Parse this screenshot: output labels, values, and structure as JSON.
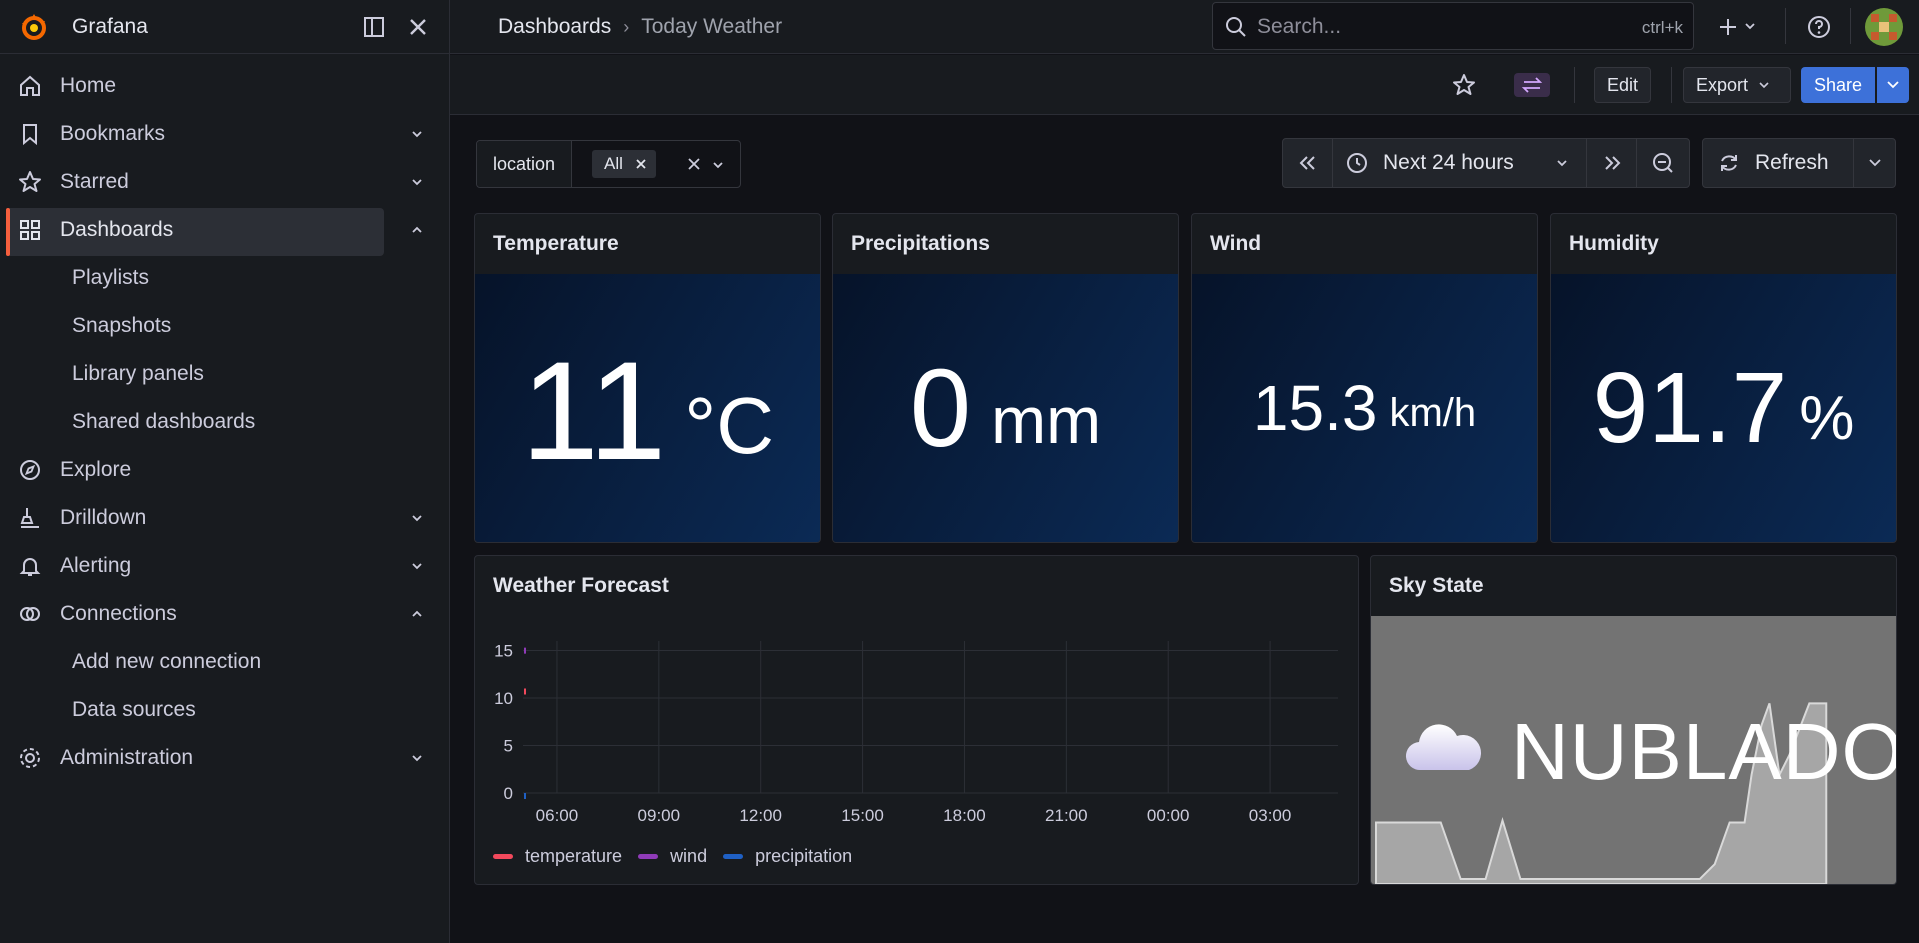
{
  "app": {
    "name": "Grafana"
  },
  "sidebar": {
    "items": [
      {
        "label": "Home",
        "icon": "home-icon"
      },
      {
        "label": "Bookmarks",
        "icon": "bookmark-icon"
      },
      {
        "label": "Starred",
        "icon": "star-icon"
      },
      {
        "label": "Dashboards",
        "icon": "dashboards-icon",
        "active": true
      },
      {
        "label": "Playlists"
      },
      {
        "label": "Snapshots"
      },
      {
        "label": "Library panels"
      },
      {
        "label": "Shared dashboards"
      },
      {
        "label": "Explore",
        "icon": "compass-icon"
      },
      {
        "label": "Drilldown",
        "icon": "drilldown-icon"
      },
      {
        "label": "Alerting",
        "icon": "bell-icon"
      },
      {
        "label": "Connections",
        "icon": "connections-icon"
      },
      {
        "label": "Add new connection"
      },
      {
        "label": "Data sources"
      },
      {
        "label": "Administration",
        "icon": "gear-icon"
      }
    ]
  },
  "header": {
    "breadcrumb": [
      "Dashboards",
      "Today Weather"
    ],
    "search_placeholder": "Search...",
    "search_shortcut": "ctrl+k"
  },
  "toolbar": {
    "edit_label": "Edit",
    "export_label": "Export",
    "share_label": "Share"
  },
  "variables": {
    "name": "location",
    "value": "All"
  },
  "time": {
    "range_label": "Next 24 hours",
    "refresh_label": "Refresh"
  },
  "panels": {
    "temperature": {
      "title": "Temperature",
      "value": "11",
      "unit": "°C"
    },
    "precipitations": {
      "title": "Precipitations",
      "value": "0",
      "unit": "mm"
    },
    "wind": {
      "title": "Wind",
      "value": "15.3",
      "unit": "km/h"
    },
    "humidity": {
      "title": "Humidity",
      "value": "91.7",
      "unit": "%"
    },
    "forecast": {
      "title": "Weather Forecast"
    },
    "sky": {
      "title": "Sky State",
      "value": "NUBLADO"
    }
  },
  "chart_data": {
    "type": "line",
    "title": "Weather Forecast",
    "x": [
      "06:00",
      "09:00",
      "12:00",
      "15:00",
      "18:00",
      "21:00",
      "00:00",
      "03:00"
    ],
    "ylim": [
      0,
      16
    ],
    "yticks": [
      0,
      5,
      10,
      15
    ],
    "grid": true,
    "legend_position": "bottom-left",
    "series": [
      {
        "name": "temperature",
        "color": "#f2495c",
        "points": [
          {
            "x": "05:00",
            "y": 11
          }
        ]
      },
      {
        "name": "wind",
        "color": "#8f3bb8",
        "points": [
          {
            "x": "05:00",
            "y": 15.3
          }
        ]
      },
      {
        "name": "precipitation",
        "color": "#1f60c4",
        "points": [
          {
            "x": "05:00",
            "y": 0
          }
        ]
      }
    ]
  },
  "colors": {
    "brand": "#f55f3e",
    "share": "#3d71d9",
    "stat_bg_start": "#061329",
    "stat_bg_end": "#0b2a55",
    "sky_bg": "#737373"
  }
}
